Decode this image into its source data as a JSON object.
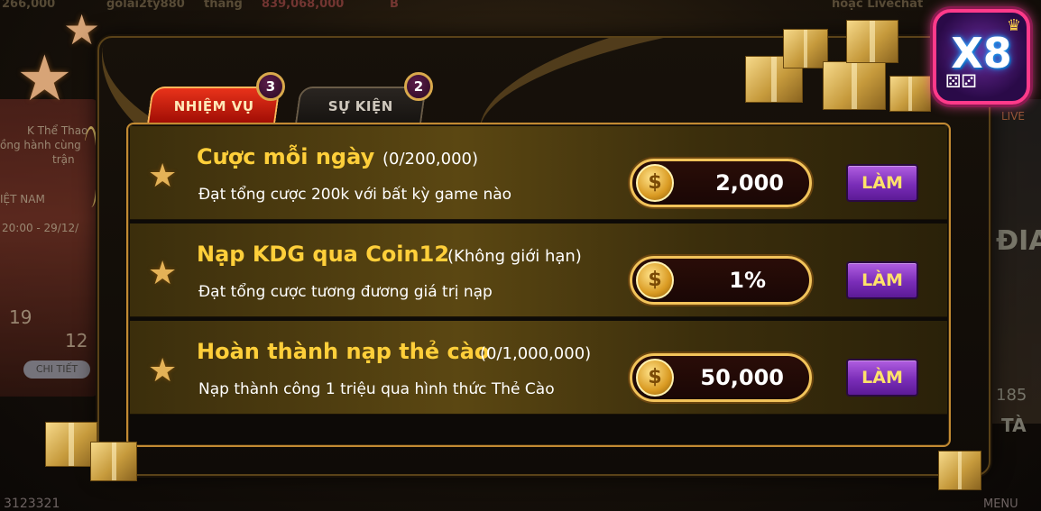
{
  "background": {
    "top_texts": [
      "266,000",
      "golai2ty880",
      "thắng",
      "839,068,000",
      "B",
      "hoặc Livechat"
    ],
    "left_texts": [
      "K Thể Thao",
      "ồng hành cùng",
      "trận",
      "IỆT NAM",
      "20:00 - 29/12/",
      "19",
      "12"
    ],
    "left_button": "CHI TIẾT",
    "right_texts": [
      "LIVE",
      "ĐIA",
      "185",
      "TÀ",
      "MENU"
    ],
    "bottom_texts": [
      "3123321"
    ]
  },
  "logo": {
    "text": "X8",
    "crown": "♛",
    "dice": "⚄⚂"
  },
  "tabs": [
    {
      "label": "NHIỆM VỤ",
      "count": "3",
      "active": true
    },
    {
      "label": "SỰ KIỆN",
      "count": "2",
      "active": false
    }
  ],
  "missions": [
    {
      "title": "Cược mỗi ngày",
      "progress": "(0/200,000)",
      "description": "Đạt tổng cược 200k với bất kỳ game nào",
      "reward": "2,000",
      "button": "LÀM"
    },
    {
      "title": "Nạp KDG qua Coin12",
      "progress": "(Không giới hạn)",
      "description": "Đạt tổng cược tương đương giá trị nạp",
      "reward": "1%",
      "button": "LÀM"
    },
    {
      "title": "Hoàn thành nạp thẻ cào",
      "progress": "(0/1,000,000)",
      "description": "Nạp thành công 1 triệu qua hình thức Thẻ Cào",
      "reward": "50,000",
      "button": "LÀM"
    }
  ],
  "icons": {
    "star": "★",
    "coin": "$"
  },
  "colors": {
    "title_gold": "#ffcf3a",
    "button_purple": "#7a2db8",
    "button_text": "#ffe26a",
    "tab_active_red": "#c8200e"
  }
}
